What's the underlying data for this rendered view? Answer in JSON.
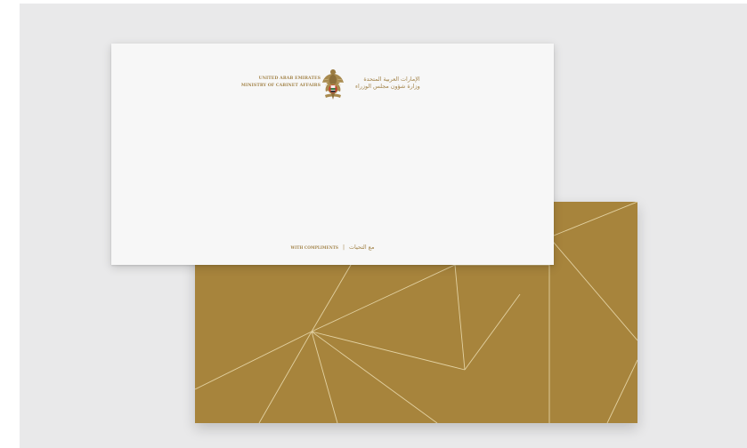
{
  "colors": {
    "backdrop": "#e9e9ea",
    "gold": "#a7843c",
    "gold_lines": "#e6d6a8",
    "card_white": "#f7f7f7",
    "text_gold": "#a3844a"
  },
  "letterhead": {
    "english_line_1": "UNITED ARAB EMIRATES",
    "english_line_2": "MINISTRY OF CABINET AFFAIRS",
    "arabic_line_1": "الإمارات العربية المتحدة",
    "arabic_line_2": "وزارة شؤون مجلس الوزراء",
    "emblem_icon": "uae-falcon-emblem"
  },
  "compliments": {
    "english": "WITH COMPLIMENTS",
    "separator": "|",
    "arabic": "مع التحيات"
  }
}
